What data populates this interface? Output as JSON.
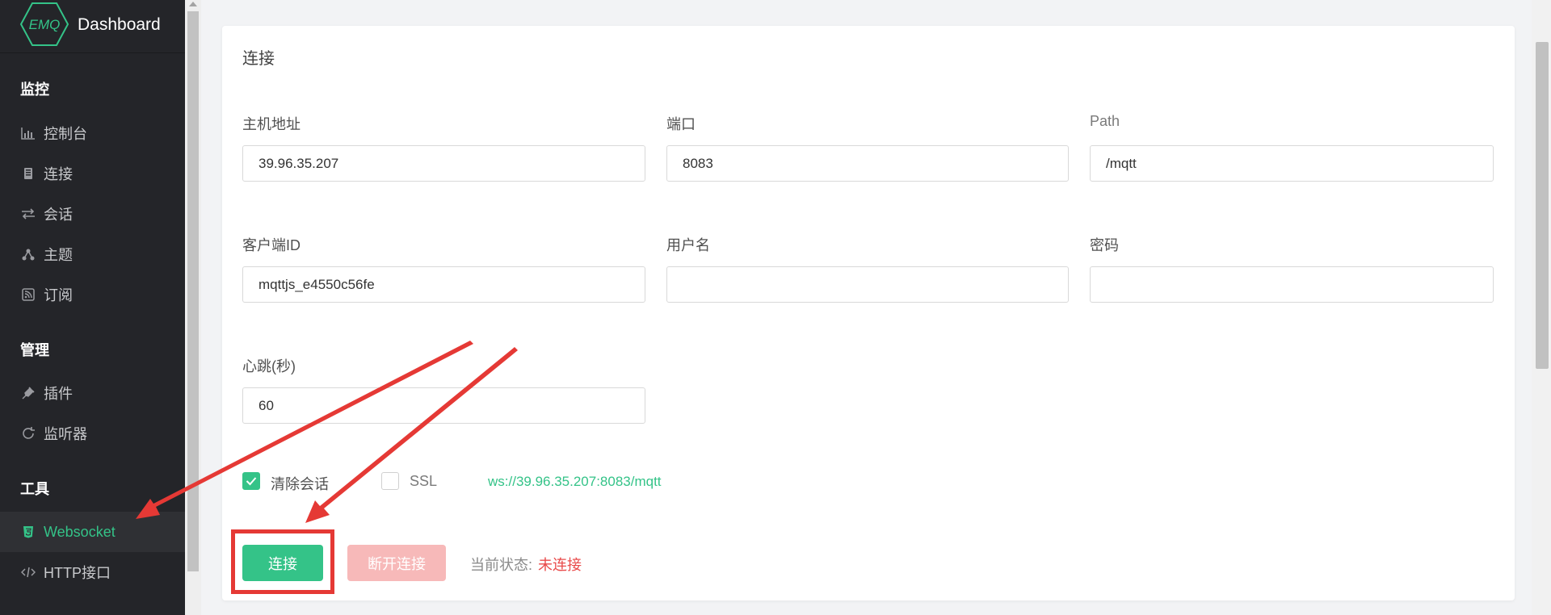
{
  "brand": {
    "logo_text": "EMQ",
    "title": "Dashboard"
  },
  "sidebar": {
    "groups": [
      {
        "title": "监控"
      },
      {
        "title": "管理"
      },
      {
        "title": "工具"
      }
    ],
    "items": [
      {
        "label": "控制台",
        "icon": "bar-chart-icon"
      },
      {
        "label": "连接",
        "icon": "device-icon"
      },
      {
        "label": "会话",
        "icon": "swap-arrows-icon"
      },
      {
        "label": "主题",
        "icon": "topic-nodes-icon"
      },
      {
        "label": "订阅",
        "icon": "rss-icon"
      },
      {
        "label": "插件",
        "icon": "plug-icon"
      },
      {
        "label": "监听器",
        "icon": "refresh-circle-icon"
      },
      {
        "label": "Websocket",
        "icon": "html5-icon",
        "active": true
      },
      {
        "label": "HTTP接口",
        "icon": "code-icon"
      }
    ]
  },
  "main": {
    "section_title": "连接",
    "fields": {
      "host": {
        "label": "主机地址",
        "value": "39.96.35.207"
      },
      "port": {
        "label": "端口",
        "value": "8083"
      },
      "path": {
        "label": "Path",
        "value": "/mqtt"
      },
      "client_id": {
        "label": "客户端ID",
        "value": "mqttjs_e4550c56fe"
      },
      "username": {
        "label": "用户名",
        "value": ""
      },
      "password": {
        "label": "密码",
        "value": ""
      },
      "keepalive": {
        "label": "心跳(秒)",
        "value": "60"
      }
    },
    "options": {
      "clean_session": {
        "label": "清除会话",
        "checked": true
      },
      "ssl": {
        "label": "SSL",
        "checked": false
      },
      "ws_url": "ws://39.96.35.207:8083/mqtt"
    },
    "actions": {
      "connect_label": "连接",
      "disconnect_label": "断开连接",
      "status_label": "当前状态:",
      "status_value": "未连接"
    }
  },
  "colors": {
    "accent": "#34c388",
    "sidebar_bg": "#242529",
    "annotation_red": "#e53935",
    "status_red": "#e94b4b"
  }
}
